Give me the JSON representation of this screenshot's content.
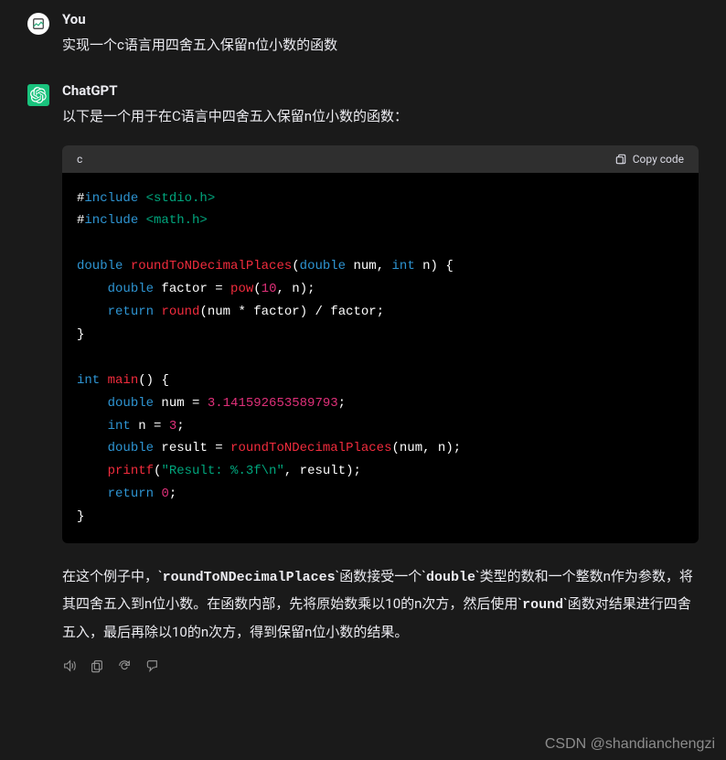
{
  "user": {
    "author": "You",
    "text": "实现一个c语言用四舍五入保留n位小数的函数"
  },
  "assistant": {
    "author": "ChatGPT",
    "intro": "以下是一个用于在C语言中四舍五入保留n位小数的函数：",
    "code": {
      "lang": "c",
      "copy_label": "Copy code",
      "tokens": [
        [
          [
            "pp",
            "#"
          ],
          [
            "kw",
            "include"
          ],
          [
            "id",
            " "
          ],
          [
            "hdr",
            "<stdio.h>"
          ]
        ],
        [
          [
            "pp",
            "#"
          ],
          [
            "kw",
            "include"
          ],
          [
            "id",
            " "
          ],
          [
            "hdr",
            "<math.h>"
          ]
        ],
        [],
        [
          [
            "type",
            "double"
          ],
          [
            "id",
            " "
          ],
          [
            "fn",
            "roundToNDecimalPlaces"
          ],
          [
            "punc",
            "("
          ],
          [
            "type",
            "double"
          ],
          [
            "id",
            " num, "
          ],
          [
            "type",
            "int"
          ],
          [
            "id",
            " n"
          ],
          [
            "punc",
            ") {"
          ]
        ],
        [
          [
            "id",
            "    "
          ],
          [
            "type",
            "double"
          ],
          [
            "id",
            " factor = "
          ],
          [
            "fn",
            "pow"
          ],
          [
            "punc",
            "("
          ],
          [
            "num",
            "10"
          ],
          [
            "id",
            ", n"
          ],
          [
            "punc",
            ");"
          ]
        ],
        [
          [
            "id",
            "    "
          ],
          [
            "kw",
            "return"
          ],
          [
            "id",
            " "
          ],
          [
            "fn",
            "round"
          ],
          [
            "punc",
            "("
          ],
          [
            "id",
            "num * factor"
          ],
          [
            "punc",
            ")"
          ],
          [
            "id",
            " / factor;"
          ]
        ],
        [
          [
            "punc",
            "}"
          ]
        ],
        [],
        [
          [
            "type",
            "int"
          ],
          [
            "id",
            " "
          ],
          [
            "fn",
            "main"
          ],
          [
            "punc",
            "() {"
          ]
        ],
        [
          [
            "id",
            "    "
          ],
          [
            "type",
            "double"
          ],
          [
            "id",
            " num = "
          ],
          [
            "num",
            "3.141592653589793"
          ],
          [
            "punc",
            ";"
          ]
        ],
        [
          [
            "id",
            "    "
          ],
          [
            "type",
            "int"
          ],
          [
            "id",
            " n = "
          ],
          [
            "num",
            "3"
          ],
          [
            "punc",
            ";"
          ]
        ],
        [
          [
            "id",
            "    "
          ],
          [
            "type",
            "double"
          ],
          [
            "id",
            " result = "
          ],
          [
            "fn",
            "roundToNDecimalPlaces"
          ],
          [
            "punc",
            "("
          ],
          [
            "id",
            "num, n"
          ],
          [
            "punc",
            ");"
          ]
        ],
        [
          [
            "id",
            "    "
          ],
          [
            "fn",
            "printf"
          ],
          [
            "punc",
            "("
          ],
          [
            "str",
            "\"Result: %.3f\\n\""
          ],
          [
            "id",
            ", result"
          ],
          [
            "punc",
            ");"
          ]
        ],
        [
          [
            "id",
            "    "
          ],
          [
            "kw",
            "return"
          ],
          [
            "id",
            " "
          ],
          [
            "num",
            "0"
          ],
          [
            "punc",
            ";"
          ]
        ],
        [
          [
            "punc",
            "}"
          ]
        ]
      ]
    },
    "explain_parts": [
      {
        "t": "plain",
        "v": "在这个例子中，`"
      },
      {
        "t": "code",
        "v": "roundToNDecimalPlaces"
      },
      {
        "t": "plain",
        "v": "`函数接受一个`"
      },
      {
        "t": "code",
        "v": "double"
      },
      {
        "t": "plain",
        "v": "`类型的数和一个整数n作为参数，将其四舍五入到n位小数。在函数内部，先将原始数乘以10的n次方，然后使用`"
      },
      {
        "t": "code",
        "v": "round"
      },
      {
        "t": "plain",
        "v": "`函数对结果进行四舍五入，最后再除以10的n次方，得到保留n位小数的结果。"
      }
    ]
  },
  "watermark": "CSDN @shandianchengzi"
}
